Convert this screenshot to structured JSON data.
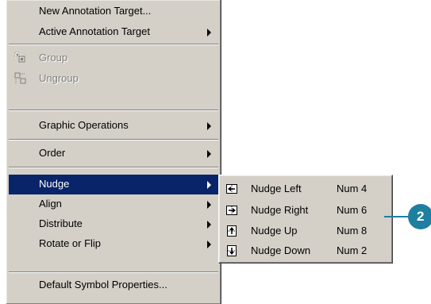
{
  "menu": {
    "items": [
      {
        "label": "New Annotation Target...",
        "submenu": false,
        "disabled": false
      },
      {
        "label": "Active Annotation Target",
        "submenu": true,
        "disabled": false
      },
      {
        "label": "Group",
        "icon": "group-icon",
        "disabled": true
      },
      {
        "label": "Ungroup",
        "icon": "ungroup-icon",
        "disabled": true
      },
      {
        "label": "Graphic Operations",
        "submenu": true,
        "disabled": false
      },
      {
        "label": "Order",
        "submenu": true,
        "disabled": false
      },
      {
        "label": "Nudge",
        "submenu": true,
        "selected": true,
        "disabled": false
      },
      {
        "label": "Align",
        "submenu": true,
        "disabled": false
      },
      {
        "label": "Distribute",
        "submenu": true,
        "disabled": false
      },
      {
        "label": "Rotate or Flip",
        "submenu": true,
        "disabled": false
      },
      {
        "label": "Default Symbol Properties...",
        "submenu": false,
        "disabled": false
      }
    ]
  },
  "submenu": {
    "items": [
      {
        "label": "Nudge Left",
        "shortcut": "Num 4",
        "icon": "nudge-left-icon"
      },
      {
        "label": "Nudge Right",
        "shortcut": "Num 6",
        "icon": "nudge-right-icon"
      },
      {
        "label": "Nudge Up",
        "shortcut": "Num 8",
        "icon": "nudge-up-icon"
      },
      {
        "label": "Nudge Down",
        "shortcut": "Num 2",
        "icon": "nudge-down-icon"
      }
    ]
  },
  "callout": {
    "number": "2",
    "color": "#1e7fa0"
  },
  "colors": {
    "menu_bg": "#d4d0c8",
    "highlight": "#0a246a",
    "disabled_text": "#808080"
  }
}
